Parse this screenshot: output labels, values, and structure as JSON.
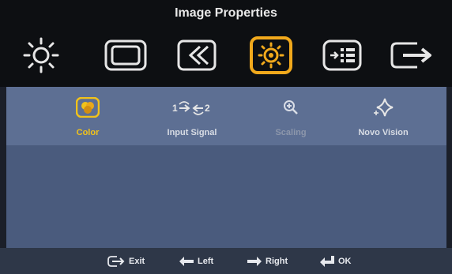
{
  "osd": {
    "title": "Image Properties",
    "main_menu": [
      {
        "icon": "brightness-icon"
      },
      {
        "icon": "monitor-position-icon"
      },
      {
        "icon": "image-setup-icon"
      },
      {
        "icon": "image-properties-icon",
        "selected": true
      },
      {
        "icon": "options-icon"
      },
      {
        "icon": "exit-menu-icon"
      }
    ],
    "sub_menu": [
      {
        "label": "Color",
        "icon": "color-icon",
        "state": "active"
      },
      {
        "label": "Input Signal",
        "icon": "input-signal-icon",
        "state": "normal"
      },
      {
        "label": "Scaling",
        "icon": "zoom-icon",
        "state": "disabled"
      },
      {
        "label": "Novo Vision",
        "icon": "novo-vision-icon",
        "state": "normal"
      }
    ],
    "footer": {
      "exit": "Exit",
      "left": "Left",
      "right": "Right",
      "ok": "OK"
    },
    "colors": {
      "selected_accent": "#f1a91c",
      "active_label": "#f1c21a",
      "panel_bg": "#5d6f93",
      "icon_color": "#e6e6e6"
    }
  }
}
